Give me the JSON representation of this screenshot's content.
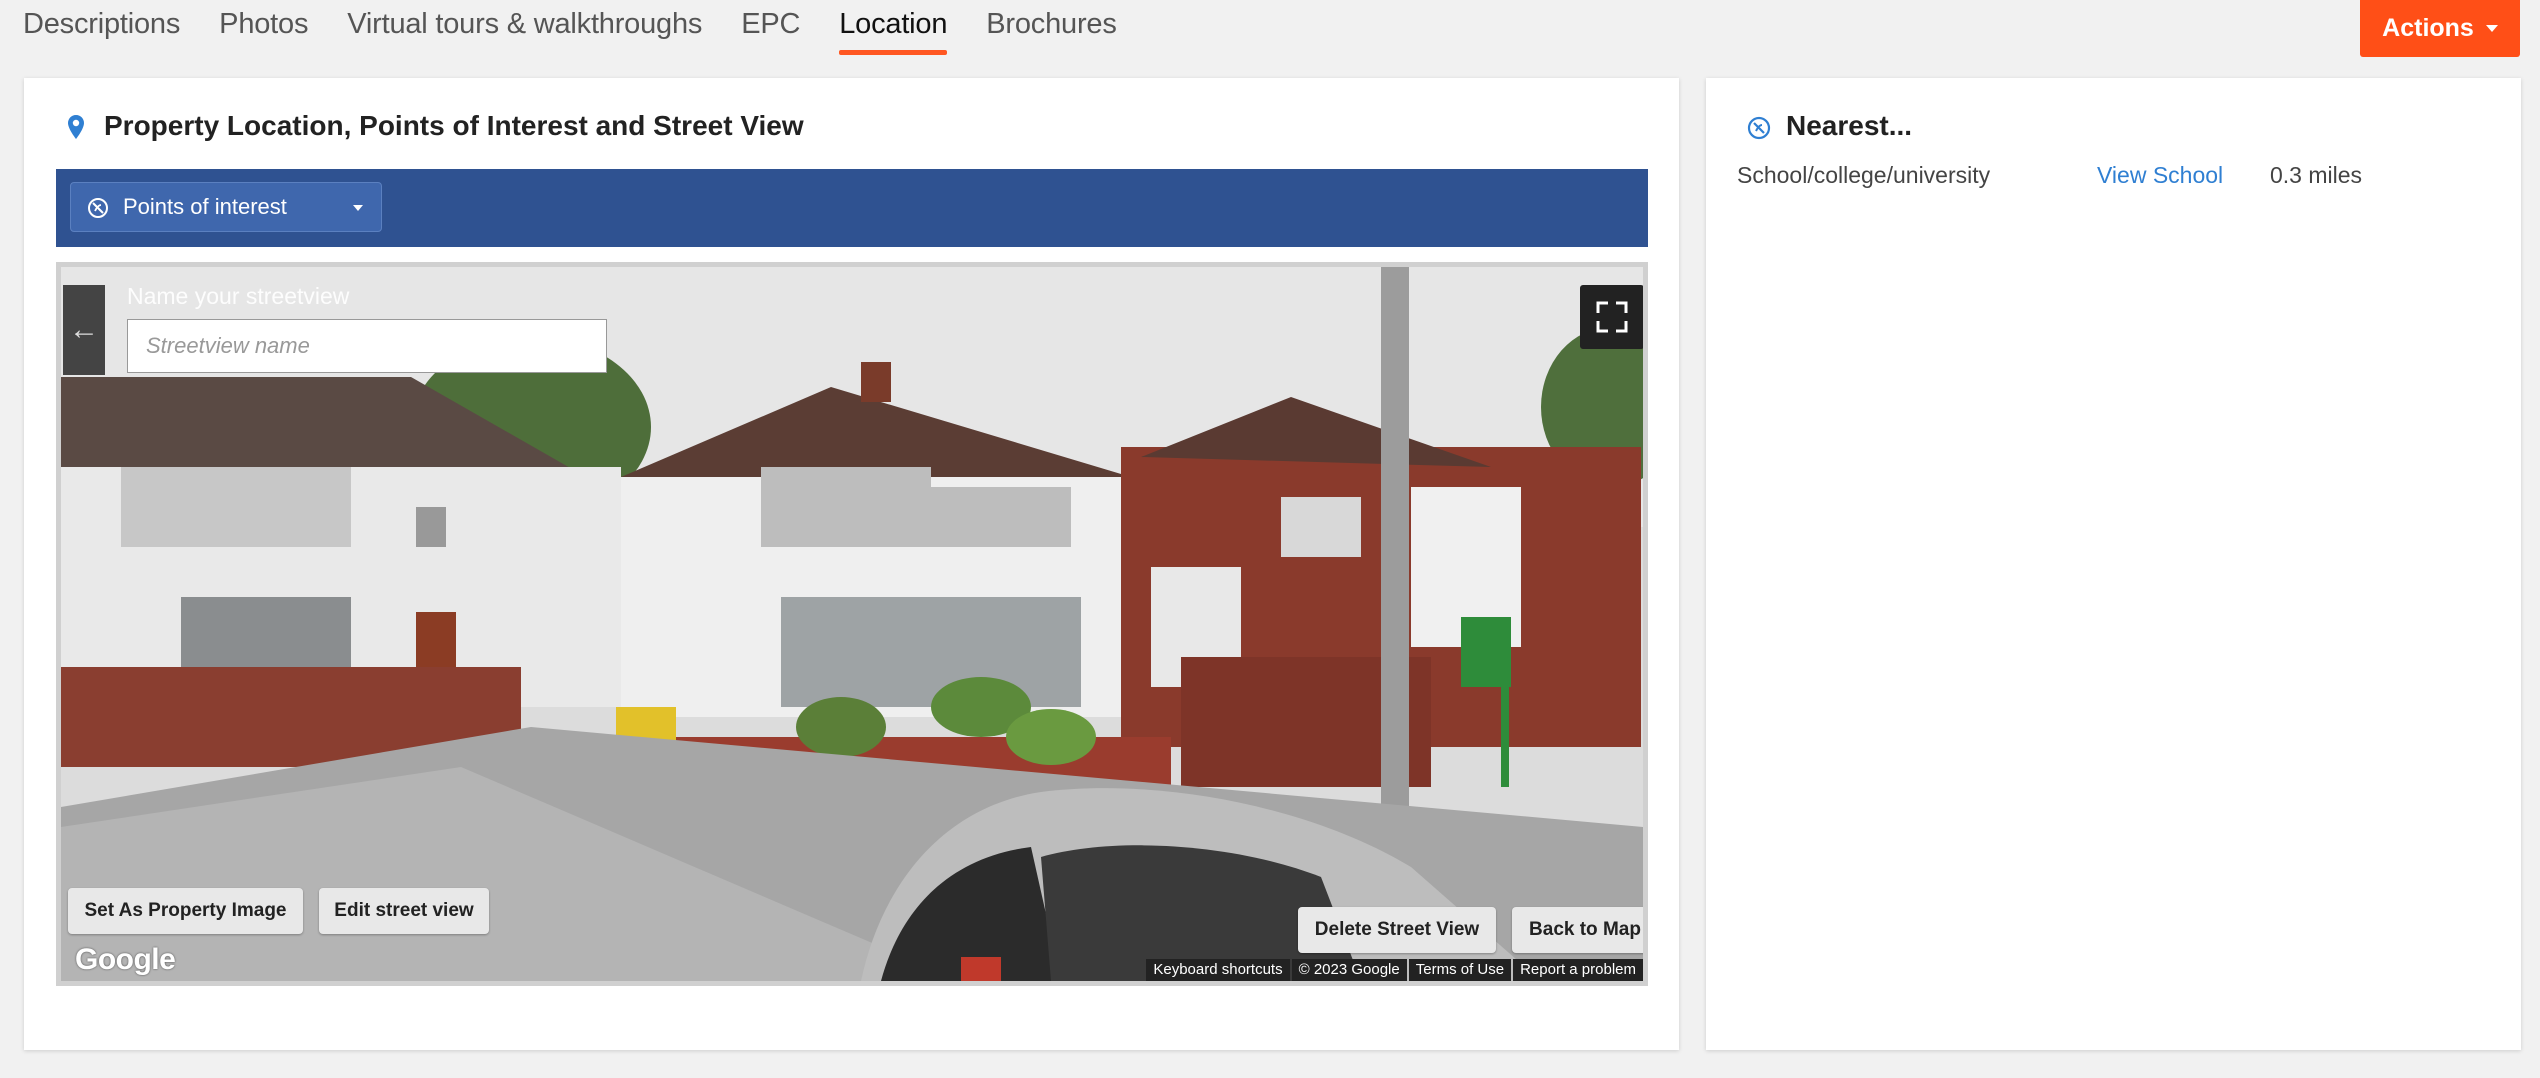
{
  "tabs": [
    {
      "label": "Descriptions",
      "active": false
    },
    {
      "label": "Photos",
      "active": false
    },
    {
      "label": "Virtual tours & walkthroughs",
      "active": false
    },
    {
      "label": "EPC",
      "active": false
    },
    {
      "label": "Location",
      "active": true
    },
    {
      "label": "Brochures",
      "active": false
    }
  ],
  "actions": {
    "label": "Actions"
  },
  "location_panel": {
    "title": "Property Location, Points of Interest and Street View",
    "poi_select": {
      "value": "Points of interest"
    },
    "streetview": {
      "name_label": "Name your streetview",
      "name_placeholder": "Streetview name",
      "name_value": "",
      "set_image_label": "Set As Property Image",
      "edit_label": "Edit street view",
      "delete_label": "Delete Street View",
      "back_label": "Back to Map",
      "google_logo": "Google",
      "footer": {
        "keyboard": "Keyboard shortcuts",
        "copyright": "© 2023 Google",
        "terms": "Terms of Use",
        "report": "Report a problem"
      }
    }
  },
  "nearest_panel": {
    "title": "Nearest...",
    "items": [
      {
        "category": "School/college/university",
        "link": "View School",
        "distance": "0.3 miles"
      }
    ]
  },
  "colors": {
    "accent": "#ff5722",
    "toolbar": "#2f5291",
    "link": "#2f7fd2"
  }
}
